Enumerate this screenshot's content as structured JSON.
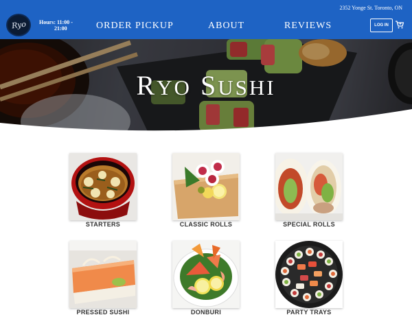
{
  "header": {
    "address": "2352 Yonge St. Toronto, ON",
    "logo_text": "Ryo",
    "hours_line1": "Hours: 11:00 -",
    "hours_line2": "21:00",
    "nav": {
      "order_pickup": "ORDER PICKUP",
      "about": "ABOUT",
      "reviews": "REVIEWS"
    },
    "login_label": "LOG IN",
    "cart_icon": "cart-icon"
  },
  "hero": {
    "title_word1_cap": "R",
    "title_word1_rest": "YO",
    "title_word2_cap": "S",
    "title_word2_rest": "USHI"
  },
  "menu": {
    "items": [
      {
        "label": "STARTERS",
        "icon": "miso-soup"
      },
      {
        "label": "CLASSIC ROLLS",
        "icon": "maki-rolls"
      },
      {
        "label": "SPECIAL ROLLS",
        "icon": "special-rolls"
      },
      {
        "label": "PRESSED SUSHI",
        "icon": "pressed-sushi"
      },
      {
        "label": "DONBURI",
        "icon": "donburi-bowl"
      },
      {
        "label": "PARTY TRAYS",
        "icon": "party-tray"
      }
    ]
  },
  "colors": {
    "header_bg": "#1e63c4",
    "text_white": "#ffffff",
    "label_text": "#333333"
  }
}
